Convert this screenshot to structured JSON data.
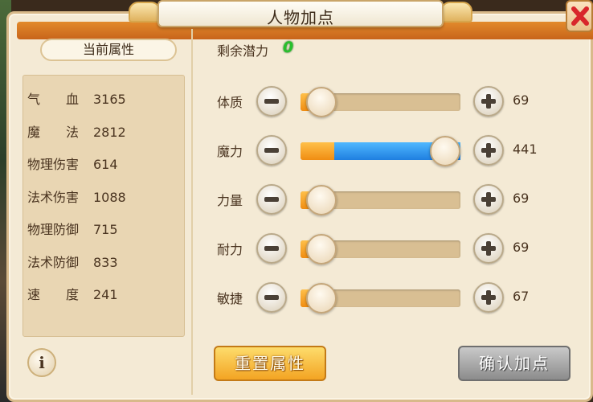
{
  "window": {
    "title": "人物加点"
  },
  "left_panel": {
    "header": "当前属性",
    "stats": [
      {
        "label": "气　　血",
        "value": "3165"
      },
      {
        "label": "魔　　法",
        "value": "2812"
      },
      {
        "label": "物理伤害",
        "value": "614"
      },
      {
        "label": "法术伤害",
        "value": "1088"
      },
      {
        "label": "物理防御",
        "value": "715"
      },
      {
        "label": "法术防御",
        "value": "833"
      },
      {
        "label": "速　　度",
        "value": "241"
      }
    ],
    "info_button": "i"
  },
  "right_panel": {
    "remaining_label": "剩余潜力",
    "remaining_value": "0",
    "attributes": [
      {
        "label": "体质",
        "value": "69",
        "base_fraction": 0.13,
        "allocated_fraction": 0.0
      },
      {
        "label": "魔力",
        "value": "441",
        "base_fraction": 0.21,
        "allocated_fraction": 0.79
      },
      {
        "label": "力量",
        "value": "69",
        "base_fraction": 0.13,
        "allocated_fraction": 0.0
      },
      {
        "label": "耐力",
        "value": "69",
        "base_fraction": 0.13,
        "allocated_fraction": 0.0
      },
      {
        "label": "敏捷",
        "value": "67",
        "base_fraction": 0.13,
        "allocated_fraction": 0.0
      }
    ]
  },
  "buttons": {
    "reset": "重置属性",
    "confirm": "确认加点"
  },
  "icons": {
    "close": "close-icon",
    "minus": "minus-icon",
    "plus": "plus-icon",
    "info": "info-icon"
  },
  "colors": {
    "accent_orange": "#f08d12",
    "allocated_blue": "#1f7fe0",
    "remaining_green": "#28c02d",
    "close_red": "#d8262b"
  }
}
